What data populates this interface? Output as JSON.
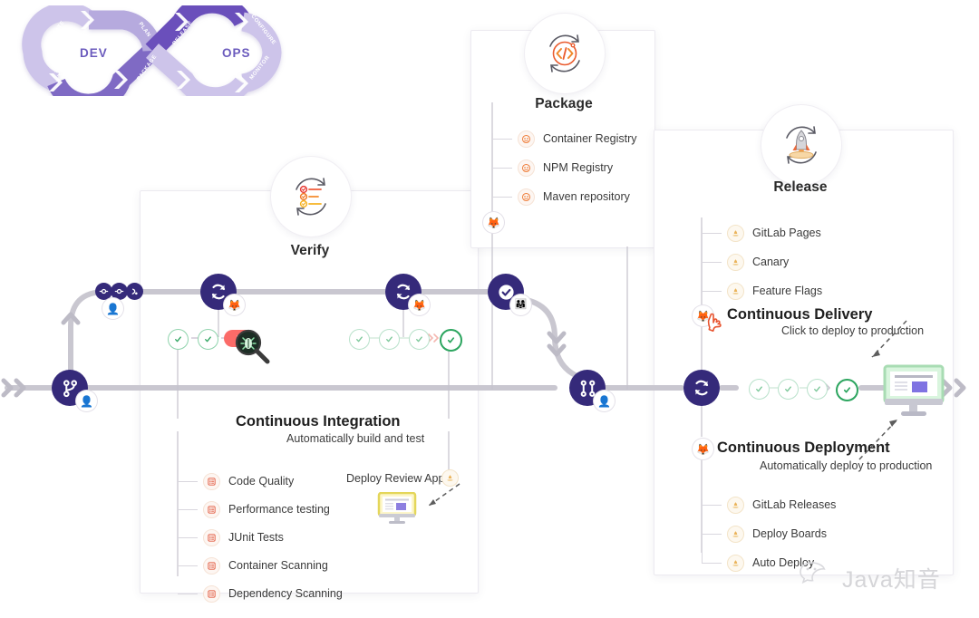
{
  "logo": {
    "dev_label": "DEV",
    "ops_label": "OPS",
    "segments": [
      "CREATE",
      "PLAN",
      "VERIFY",
      "PACKAGE",
      "RELEASE",
      "CONFIGURE",
      "MONITOR"
    ],
    "accent": "#6b4fbb",
    "accent_light": "#cdc4ea"
  },
  "stages": {
    "verify": {
      "title": "Verify",
      "icon": "checklist-cycle-icon"
    },
    "package": {
      "title": "Package",
      "icon": "code-cycle-icon",
      "items": [
        {
          "label": "Container Registry",
          "icon": "registry-icon"
        },
        {
          "label": "NPM Registry",
          "icon": "registry-icon"
        },
        {
          "label": "Maven repository",
          "icon": "registry-icon"
        }
      ]
    },
    "release": {
      "title": "Release",
      "icon": "rocket-cycle-icon",
      "items": [
        {
          "label": "GitLab Pages",
          "icon": "release-icon"
        },
        {
          "label": "Canary",
          "icon": "release-icon"
        },
        {
          "label": "Feature Flags",
          "icon": "release-icon"
        }
      ]
    }
  },
  "continuous_integration": {
    "title": "Continuous Integration",
    "subtitle": "Automatically build and test",
    "items": [
      {
        "label": "Code Quality",
        "icon": "test-list-icon"
      },
      {
        "label": "Performance testing",
        "icon": "test-list-icon"
      },
      {
        "label": "JUnit Tests",
        "icon": "test-list-icon"
      },
      {
        "label": "Container Scanning",
        "icon": "test-list-icon"
      },
      {
        "label": "Dependency Scanning",
        "icon": "test-list-icon"
      }
    ],
    "review_app_label": "Deploy Review App"
  },
  "continuous_delivery": {
    "title": "Continuous Delivery",
    "subtitle": "Click to deploy to production"
  },
  "continuous_deployment": {
    "title": "Continuous Deployment",
    "subtitle": "Automatically deploy to production",
    "items": [
      {
        "label": "GitLab Releases",
        "icon": "release-icon"
      },
      {
        "label": "Deploy Boards",
        "icon": "release-icon"
      },
      {
        "label": "Auto Deploy",
        "icon": "release-icon"
      }
    ]
  },
  "pipeline": {
    "nodes": [
      {
        "name": "branch-node",
        "icon": "git-branch-icon"
      },
      {
        "name": "pipeline-node-1",
        "icon": "sync-icon"
      },
      {
        "name": "pipeline-node-2",
        "icon": "sync-icon"
      },
      {
        "name": "approval-node",
        "icon": "check-circle-icon"
      },
      {
        "name": "merge-node",
        "icon": "merge-request-icon"
      },
      {
        "name": "deploy-node",
        "icon": "sync-icon"
      }
    ],
    "commit_dots": 3,
    "failed_job_marker": "bug-magnifier-icon",
    "node_color": "#352a7a",
    "rail_color": "#c9c7d0",
    "pass_color": "#2ca55f",
    "fail_color": "#fb6b68"
  },
  "watermark": {
    "text": "Java知音",
    "icon": "wechat-icon"
  }
}
